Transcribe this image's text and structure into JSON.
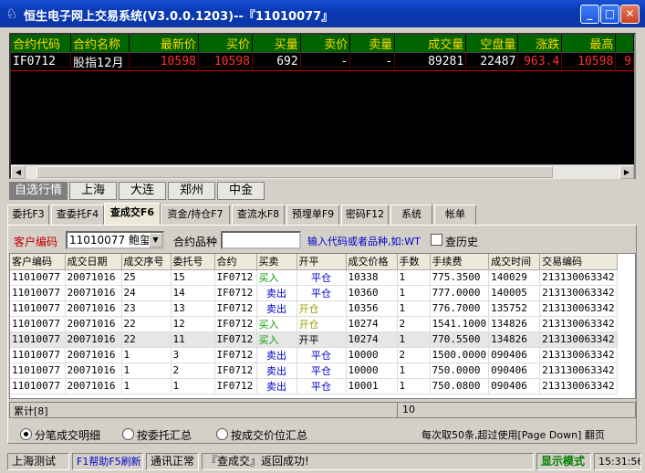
{
  "window": {
    "title": "恒生电子网上交易系统(V3.0.0.1203)--『11010077』",
    "min": "_",
    "max": "□",
    "close": "✕"
  },
  "quote": {
    "headers": [
      "合约代码",
      "合约名称",
      "最新价",
      "买价",
      "买量",
      "卖价",
      "卖量",
      "成交量",
      "空盘量",
      "涨跌",
      "最高"
    ],
    "row": [
      "IF0712",
      "股指12月",
      "10598",
      "10598",
      "692",
      "-",
      "-",
      "89281",
      "22487",
      "963.4",
      "10598"
    ],
    "overflow": "9"
  },
  "market_tabs": [
    "自选行情",
    "上海",
    "大连",
    "郑州",
    "中金"
  ],
  "sub_tabs": [
    "委托F3",
    "查委托F4",
    "查成交F6",
    "资金/持仓F7",
    "查流水F8",
    "预埋单F9",
    "密码F12",
    "系统",
    "帐单"
  ],
  "filter": {
    "client_label": "客户编码",
    "client_value": "11010077 鲍玺",
    "contract_label": "合约品种",
    "contract_value": "",
    "hint": "输入代码或者品种,如:WT",
    "history_label": "查历史"
  },
  "grid": {
    "headers": [
      "客户编码",
      "成交日期",
      "成交序号",
      "委托号",
      "合约",
      "买卖",
      "开平",
      "成交价格",
      "手数",
      "手续费",
      "成交时间",
      "交易编码"
    ],
    "rows": [
      [
        "11010077",
        "20071016",
        "25",
        "15",
        "IF0712",
        "买入",
        "平仓",
        "10338",
        "1",
        "775.3500",
        "140029",
        "213130063342"
      ],
      [
        "11010077",
        "20071016",
        "24",
        "14",
        "IF0712",
        "卖出",
        "平仓",
        "10360",
        "1",
        "777.0000",
        "140005",
        "213130063342"
      ],
      [
        "11010077",
        "20071016",
        "23",
        "13",
        "IF0712",
        "卖出",
        "开仓",
        "10356",
        "1",
        "776.7000",
        "135752",
        "213130063342"
      ],
      [
        "11010077",
        "20071016",
        "22",
        "12",
        "IF0712",
        "买入",
        "开仓",
        "10274",
        "2",
        "1541.1000",
        "134826",
        "213130063342"
      ],
      [
        "11010077",
        "20071016",
        "22",
        "11",
        "IF0712",
        "买入",
        "开平",
        "10274",
        "1",
        "770.5500",
        "134826",
        "213130063342"
      ],
      [
        "11010077",
        "20071016",
        "1",
        "3",
        "IF0712",
        "卖出",
        "平仓",
        "10000",
        "2",
        "1500.0000",
        "090406",
        "213130063342"
      ],
      [
        "11010077",
        "20071016",
        "1",
        "2",
        "IF0712",
        "卖出",
        "平仓",
        "10000",
        "1",
        "750.0000",
        "090406",
        "213130063342"
      ],
      [
        "11010077",
        "20071016",
        "1",
        "1",
        "IF0712",
        "卖出",
        "平仓",
        "10001",
        "1",
        "750.0800",
        "090406",
        "213130063342"
      ]
    ],
    "selected_row": 4
  },
  "summary": {
    "label": "累计[8]",
    "qty": "10"
  },
  "options": {
    "radio1": "分笔成交明细",
    "radio2": "按委托汇总",
    "radio3": "按成交价位汇总",
    "note": "每次取50条,超过使用[Page Down] 翻页"
  },
  "status": {
    "server": "上海测试",
    "help": "F1帮助F5刷新",
    "conn": "通讯正常",
    "msg": "『查成交』返回成功!",
    "mode": "显示模式",
    "time": "15:31:56"
  },
  "colors": {
    "title_bar": "#0a3ab4",
    "quote_bg": "#000000",
    "quote_header_bg": "#006400",
    "quote_header_text": "#ffd700",
    "price_red": "#ff3030",
    "buy_green": "#00a000",
    "sell_blue": "#0000c8",
    "mode_green": "#008000"
  }
}
